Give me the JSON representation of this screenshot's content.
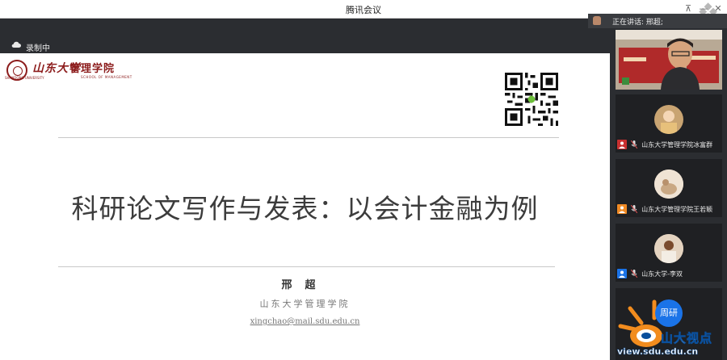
{
  "window": {
    "title": "腾讯会议"
  },
  "recording": {
    "label": "录制中"
  },
  "speaker_bar": {
    "label": "正在讲话: 邢超;"
  },
  "slide": {
    "logo_cn": "山东大学",
    "logo_school": "管理学院",
    "logo_en_left": "SHANDONG UNIVERSITY",
    "logo_en_right": "SCHOOL OF MANAGEMENT",
    "title": "科研论文写作与发表：以会计金融为例",
    "author": "邢超",
    "department": "山东大学管理学院",
    "email": "xingchao@mail.sdu.edu.cn"
  },
  "participants": [
    {
      "name": "山东大学管理学院冰富群"
    },
    {
      "name": "山东大学管理学院王若颖"
    },
    {
      "name": "山东大学-李双"
    }
  ],
  "overlay": {
    "bubble_text": "周研",
    "watermark_text": "山大视点",
    "watermark_url": "view.sdu.edu.cn"
  }
}
